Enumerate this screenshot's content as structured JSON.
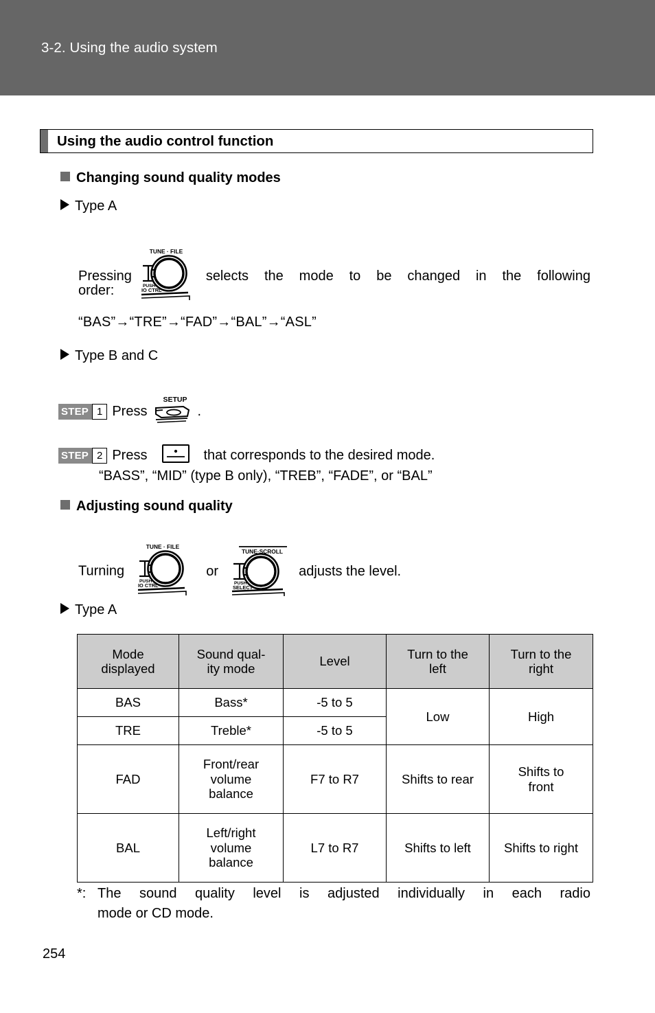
{
  "header": {
    "chapter_title": "3-2. Using the audio system",
    "band_color": "#666666"
  },
  "section": {
    "title": "Using the audio control function",
    "accent_bar_color": "#6e6e6e"
  },
  "subsections": {
    "changing_modes": {
      "heading": "Changing sound quality modes",
      "type_a_label": "Type A",
      "pressing_prefix": "Pressing",
      "pressing_suffix": "selects the mode to be changed in the following",
      "pressing_line2": "order:",
      "order_sequence": "“BAS”→“TRE”→“FAD”→“BAL”→“ASL”",
      "type_bc_label": "Type B and C",
      "step1": {
        "badge_word": "STEP",
        "badge_num": "1",
        "text_before": "Press",
        "text_after": "."
      },
      "step2": {
        "badge_word": "STEP",
        "badge_num": "2",
        "text_before": "Press",
        "text_after": "that corresponds to the desired mode.",
        "modes_line": "“BASS”, “MID” (type B only), “TREB”, “FADE”, or “BAL”"
      }
    },
    "adjusting": {
      "heading": "Adjusting sound quality",
      "turning_prefix": "Turning",
      "turning_or": "or",
      "turning_suffix": "adjusts the level.",
      "type_a_label": "Type A"
    }
  },
  "icons": {
    "tune_file_knob": {
      "top_label": "TUNE · FILE",
      "side_label_1": "PUSH",
      "side_label_2": "IO CTRL"
    },
    "tune_scroll_knob": {
      "top_label": "TUNE·SCROLL",
      "side_label_1": "PUSH",
      "side_label_2": "SELECT"
    },
    "setup_button": {
      "label": "SETUP"
    },
    "preset_button": {
      "label": ""
    }
  },
  "table": {
    "headers": [
      "Mode displayed",
      "Sound qual- ity mode",
      "Level",
      "Turn to the left",
      "Turn to the right"
    ],
    "headers_lines": {
      "col0_l1": "Mode",
      "col0_l2": "displayed",
      "col1_l1": "Sound qual-",
      "col1_l2": "ity mode",
      "col2": "Level",
      "col3_l1": "Turn to the",
      "col3_l2": "left",
      "col4_l1": "Turn to the",
      "col4_l2": "right"
    },
    "rows": [
      {
        "mode": "BAS",
        "sound_quality_mode": "Bass*",
        "level": "-5 to 5",
        "turn_left": "Low",
        "turn_right": "High"
      },
      {
        "mode": "TRE",
        "sound_quality_mode": "Treble*",
        "level": "-5 to 5",
        "turn_left": "",
        "turn_right": ""
      },
      {
        "mode": "FAD",
        "sound_quality_mode": "Front/rear volume balance",
        "sound_quality_mode_l1": "Front/rear",
        "sound_quality_mode_l2": "volume",
        "sound_quality_mode_l3": "balance",
        "level": "F7 to R7",
        "turn_left": "Shifts to rear",
        "turn_right": "Shifts to front",
        "turn_right_l1": "Shifts to",
        "turn_right_l2": "front"
      },
      {
        "mode": "BAL",
        "sound_quality_mode": "Left/right volume balance",
        "sound_quality_mode_l1": "Left/right",
        "sound_quality_mode_l2": "volume",
        "sound_quality_mode_l3": "balance",
        "level": "L7 to R7",
        "turn_left": "Shifts to left",
        "turn_right": "Shifts to right"
      }
    ],
    "header_bg": "#cccccc"
  },
  "footnote": {
    "mark": "*:",
    "line1": "The sound quality level is adjusted individually in each radio",
    "line2": "mode or CD mode."
  },
  "page_number": "254"
}
